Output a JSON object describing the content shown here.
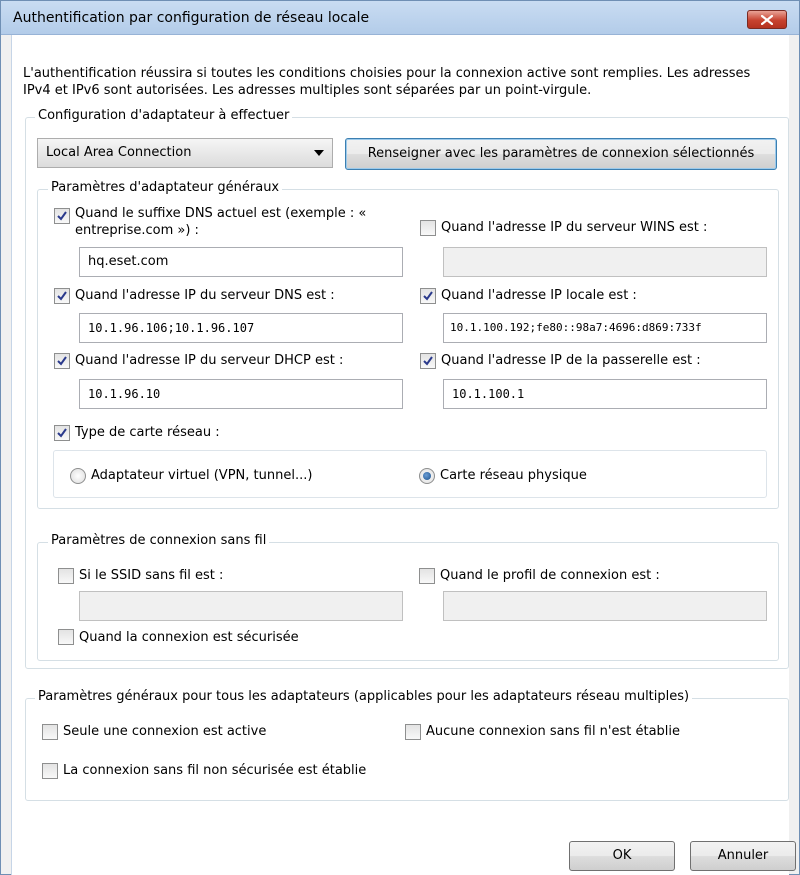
{
  "window": {
    "title": "Authentification par configuration de réseau locale"
  },
  "intro": "L'authentification réussira si toutes les conditions choisies pour la connexion active sont remplies. Les adresses IPv4 et IPv6 sont autorisées. Les adresses multiples sont séparées par un point-virgule.",
  "adapter_config": {
    "title": "Configuration d'adaptateur à effectuer",
    "selected_adapter": "Local Area Connection",
    "fill_button": "Renseigner avec les paramètres de connexion sélectionnés"
  },
  "general_params": {
    "title": "Paramètres d'adaptateur généraux",
    "dns_suffix": {
      "label": "Quand le suffixe DNS actuel est (exemple : « entreprise.com ») :",
      "checked": true,
      "value": "hq.eset.com"
    },
    "wins": {
      "label": "Quand l'adresse IP du serveur WINS est :",
      "checked": false,
      "value": ""
    },
    "dns_server": {
      "label": "Quand l'adresse IP du serveur DNS est :",
      "checked": true,
      "value": "10.1.96.106;10.1.96.107"
    },
    "local_ip": {
      "label": "Quand l'adresse IP locale est :",
      "checked": true,
      "value": "10.1.100.192;fe80::98a7:4696:d869:733f"
    },
    "dhcp": {
      "label": "Quand l'adresse IP du serveur DHCP est :",
      "checked": true,
      "value": "10.1.96.10"
    },
    "gateway": {
      "label": "Quand l'adresse IP de la passerelle est :",
      "checked": true,
      "value": "10.1.100.1"
    },
    "adapter_type": {
      "label": "Type de carte réseau :",
      "checked": true
    },
    "radio_virtual": {
      "label": "Adaptateur virtuel (VPN, tunnel...)",
      "selected": false
    },
    "radio_physical": {
      "label": "Carte réseau physique",
      "selected": true
    }
  },
  "wireless": {
    "title": "Paramètres de connexion sans fil",
    "ssid": {
      "label": "Si le SSID sans fil est :",
      "checked": false,
      "value": ""
    },
    "profile": {
      "label": "Quand le profil de connexion est :",
      "checked": false,
      "value": ""
    },
    "secured": {
      "label": "Quand la connexion est sécurisée",
      "checked": false
    }
  },
  "all_adapters": {
    "title": "Paramètres généraux pour tous les adaptateurs (applicables pour les adaptateurs réseau multiples)",
    "one_active": {
      "label": "Seule une connexion est active",
      "checked": false
    },
    "no_wireless": {
      "label": "Aucune connexion sans fil n'est établie",
      "checked": false
    },
    "unsecured_wireless": {
      "label": "La connexion sans fil non sécurisée est établie",
      "checked": false
    }
  },
  "footer": {
    "ok": "OK",
    "cancel": "Annuler"
  },
  "colors": {
    "title_bar": "#c9dcf2",
    "close_button": "#c7422f",
    "check_mark": "#2b3a8c",
    "window_border": "#6f8fb4"
  }
}
